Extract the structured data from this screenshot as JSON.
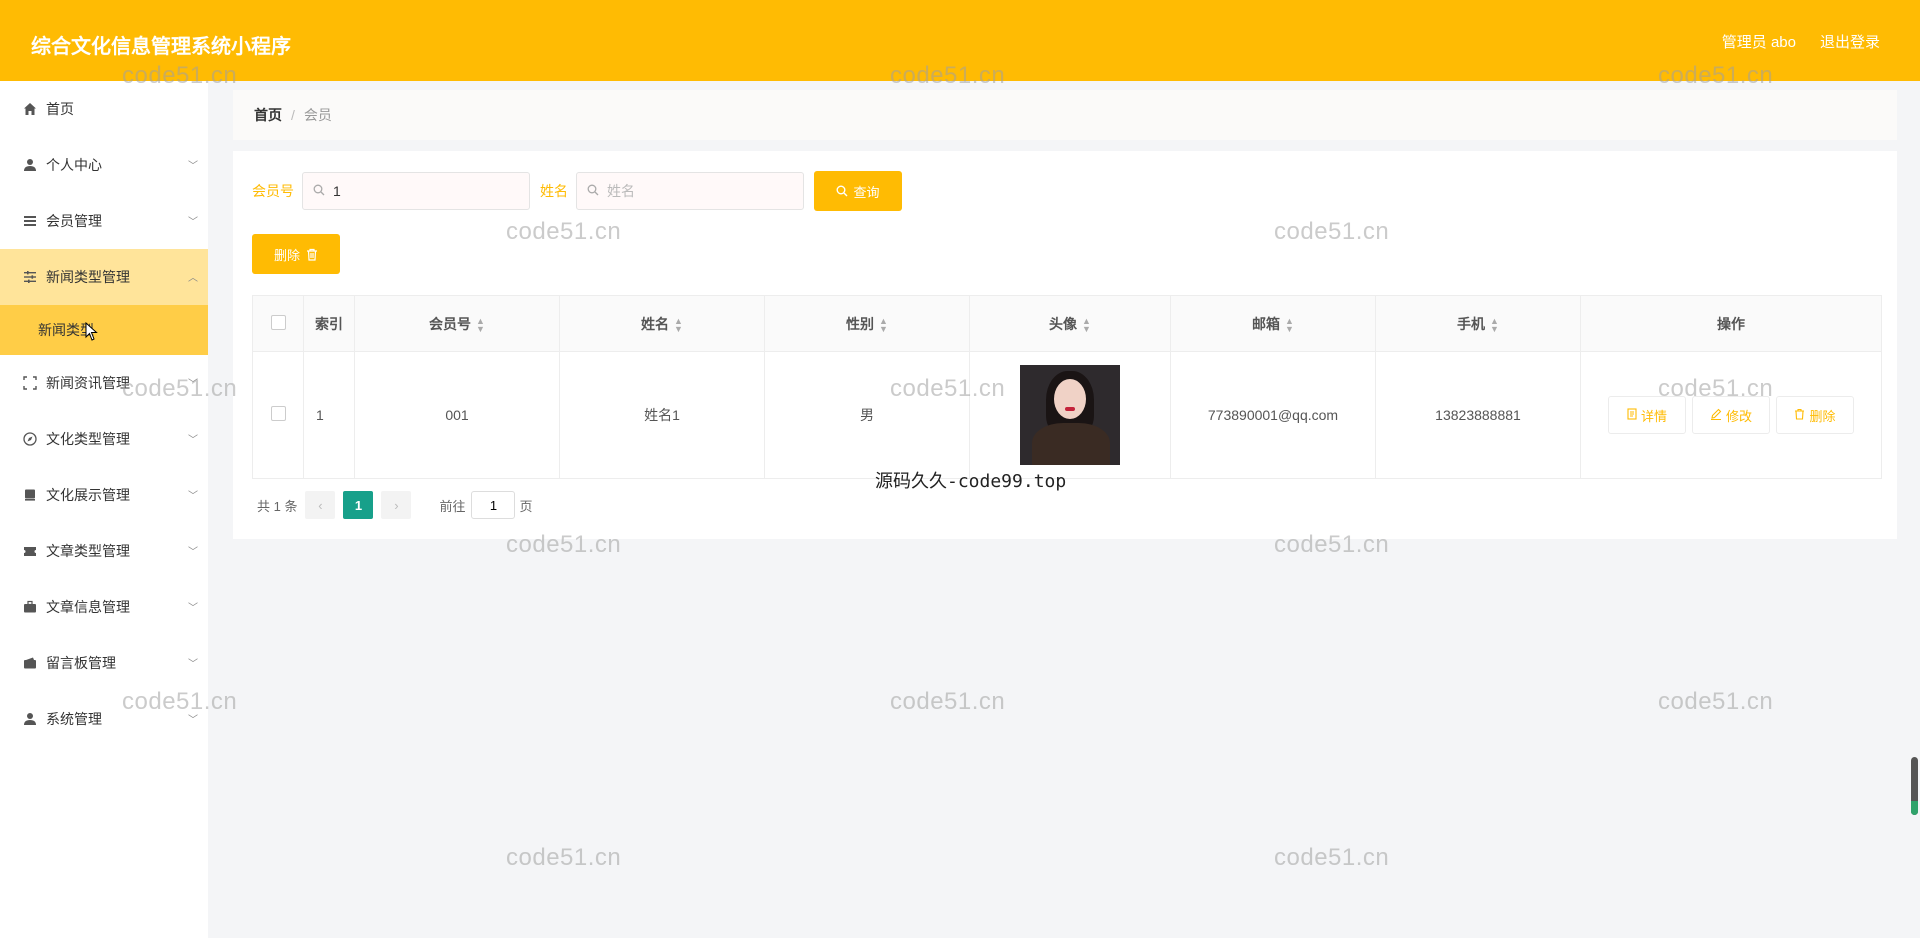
{
  "header": {
    "title": "综合文化信息管理系统小程序",
    "user_label": "管理员 abo",
    "logout_label": "退出登录"
  },
  "sidebar": {
    "items": [
      {
        "label": "首页",
        "icon": "home-icon",
        "has_children": false
      },
      {
        "label": "个人中心",
        "icon": "user-icon",
        "has_children": true
      },
      {
        "label": "会员管理",
        "icon": "menu-icon",
        "has_children": true
      },
      {
        "label": "新闻类型管理",
        "icon": "sliders-icon",
        "has_children": true,
        "expanded": true
      },
      {
        "label": "新闻资讯管理",
        "icon": "fullscreen-icon",
        "has_children": true
      },
      {
        "label": "文化类型管理",
        "icon": "compass-icon",
        "has_children": true
      },
      {
        "label": "文化展示管理",
        "icon": "book-icon",
        "has_children": true
      },
      {
        "label": "文章类型管理",
        "icon": "ticket-icon",
        "has_children": true
      },
      {
        "label": "文章信息管理",
        "icon": "briefcase-icon",
        "has_children": true
      },
      {
        "label": "留言板管理",
        "icon": "wallet-icon",
        "has_children": true
      },
      {
        "label": "系统管理",
        "icon": "admin-icon",
        "has_children": true
      }
    ],
    "sub_item": "新闻类型"
  },
  "breadcrumb": {
    "home": "首页",
    "separator": "/",
    "current": "会员"
  },
  "search": {
    "member_no_label": "会员号",
    "member_no_value": "1",
    "name_label": "姓名",
    "name_placeholder": "姓名",
    "query_button": "查询"
  },
  "actions": {
    "delete_button": "删除"
  },
  "table": {
    "headers": [
      "索引",
      "会员号",
      "姓名",
      "性别",
      "头像",
      "邮箱",
      "手机",
      "操作"
    ],
    "rows": [
      {
        "index": "1",
        "member_no": "001",
        "name": "姓名1",
        "gender": "男",
        "email": "773890001@qq.com",
        "phone": "13823888881"
      }
    ],
    "row_actions": {
      "detail": "详情",
      "edit": "修改",
      "delete": "删除"
    }
  },
  "pagination": {
    "total": "共 1 条",
    "current_page": "1",
    "goto_label": "前往",
    "goto_value": "1",
    "page_suffix": "页"
  },
  "overlay_caption": "源码久久-code99.top",
  "watermark": "code51.cn",
  "colors": {
    "accent": "#ffbb03",
    "active_bg": "#ffe49a",
    "sub_bg": "#ffcd47",
    "page_current": "#17a08a"
  }
}
